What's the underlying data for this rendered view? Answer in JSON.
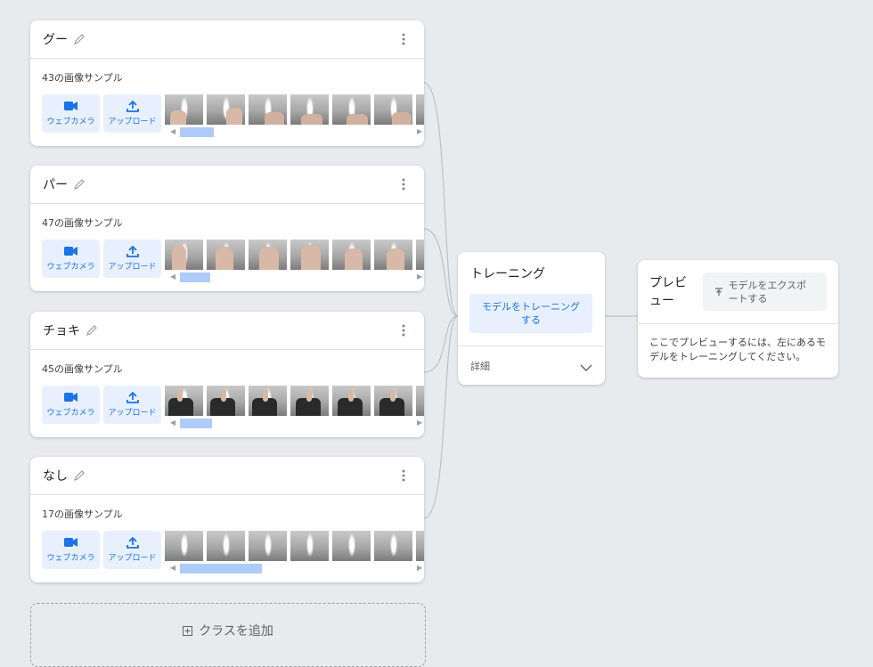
{
  "classes": [
    {
      "name": "グー",
      "samples": "43の画像サンプル",
      "webcam_label": "ウェブカメラ",
      "upload_label": "アップロード",
      "scroll_fraction": 0.17
    },
    {
      "name": "パー",
      "samples": "47の画像サンプル",
      "webcam_label": "ウェブカメラ",
      "upload_label": "アップロード",
      "scroll_fraction": 0.15
    },
    {
      "name": "チョキ",
      "samples": "45の画像サンプル",
      "webcam_label": "ウェブカメラ",
      "upload_label": "アップロード",
      "scroll_fraction": 0.16
    },
    {
      "name": "なし",
      "samples": "17の画像サンプル",
      "webcam_label": "ウェブカメラ",
      "upload_label": "アップロード",
      "scroll_fraction": 0.41
    }
  ],
  "training": {
    "title": "トレーニング",
    "train_button": "モデルをトレーニングする",
    "details": "詳細"
  },
  "preview": {
    "title": "プレビュー",
    "export_button": "モデルをエクスポートする",
    "message": "ここでプレビューするには、左にあるモデルをトレーニングしてください。"
  },
  "add_class": {
    "label": "クラスを追加"
  },
  "colors": {
    "accent": "#1a73e8",
    "accent_bg": "#e8f0fe",
    "scrollbar": "#aecbfa",
    "background": "#e8eaed"
  }
}
